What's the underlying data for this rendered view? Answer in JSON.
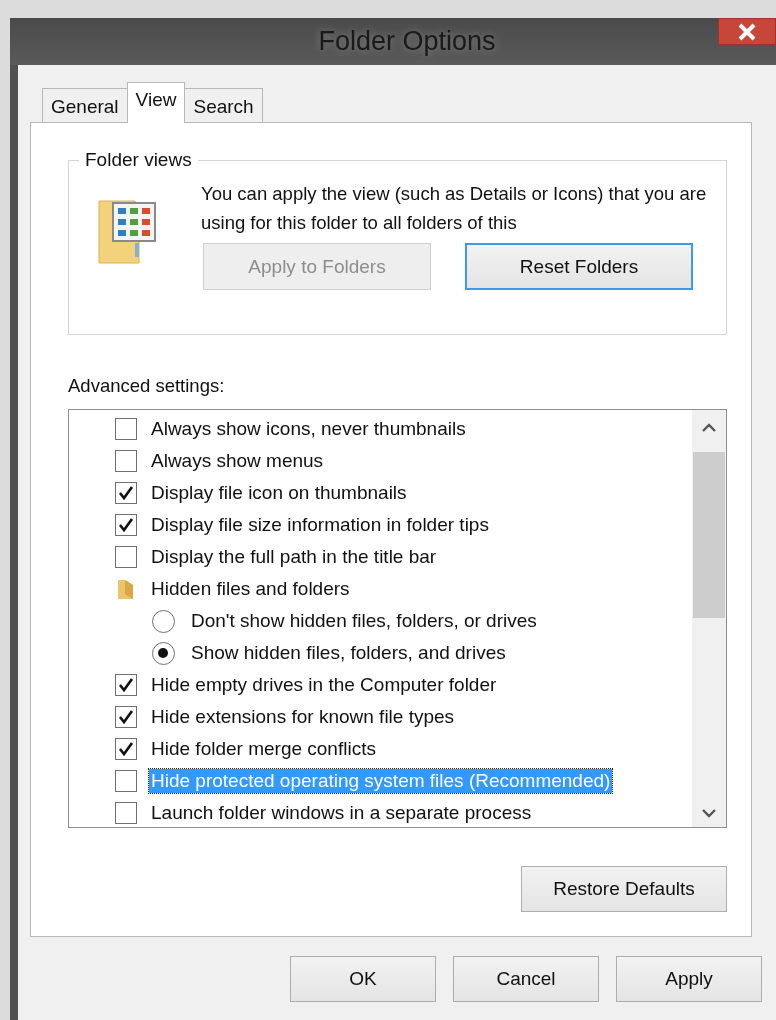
{
  "window": {
    "title": "Folder Options"
  },
  "tabs": [
    {
      "label": "General",
      "selected": false
    },
    {
      "label": "View",
      "selected": true
    },
    {
      "label": "Search",
      "selected": false
    }
  ],
  "folder_views": {
    "title": "Folder views",
    "description": "You can apply the view (such as Details or Icons) that you are using for this folder to all folders of this",
    "buttons": [
      {
        "label": "Apply to Folders",
        "disabled": true,
        "focused": false
      },
      {
        "label": "Reset Folders",
        "disabled": false,
        "focused": true
      }
    ]
  },
  "advanced_settings": {
    "label": "Advanced settings:",
    "items": [
      {
        "kind": "checkbox",
        "label": "Always show icons, never thumbnails",
        "checked": false,
        "selected": false
      },
      {
        "kind": "checkbox",
        "label": "Always show menus",
        "checked": false,
        "selected": false
      },
      {
        "kind": "checkbox",
        "label": "Display file icon on thumbnails",
        "checked": true,
        "selected": false
      },
      {
        "kind": "checkbox",
        "label": "Display file size information in folder tips",
        "checked": true,
        "selected": false
      },
      {
        "kind": "checkbox",
        "label": "Display the full path in the title bar",
        "checked": false,
        "selected": false
      },
      {
        "kind": "group",
        "label": "Hidden files and folders",
        "selected": false
      },
      {
        "kind": "radio",
        "label": "Don't show hidden files, folders, or drives",
        "checked": false,
        "selected": false
      },
      {
        "kind": "radio",
        "label": "Show hidden files, folders, and drives",
        "checked": true,
        "selected": false
      },
      {
        "kind": "checkbox",
        "label": "Hide empty drives in the Computer folder",
        "checked": true,
        "selected": false
      },
      {
        "kind": "checkbox",
        "label": "Hide extensions for known file types",
        "checked": true,
        "selected": false
      },
      {
        "kind": "checkbox",
        "label": "Hide folder merge conflicts",
        "checked": true,
        "selected": false
      },
      {
        "kind": "checkbox",
        "label": "Hide protected operating system files (Recommended)",
        "checked": false,
        "selected": true
      },
      {
        "kind": "checkbox",
        "label": "Launch folder windows in a separate process",
        "checked": false,
        "selected": false
      }
    ],
    "restore_button": "Restore Defaults"
  },
  "buttons": [
    "OK",
    "Cancel",
    "Apply"
  ]
}
